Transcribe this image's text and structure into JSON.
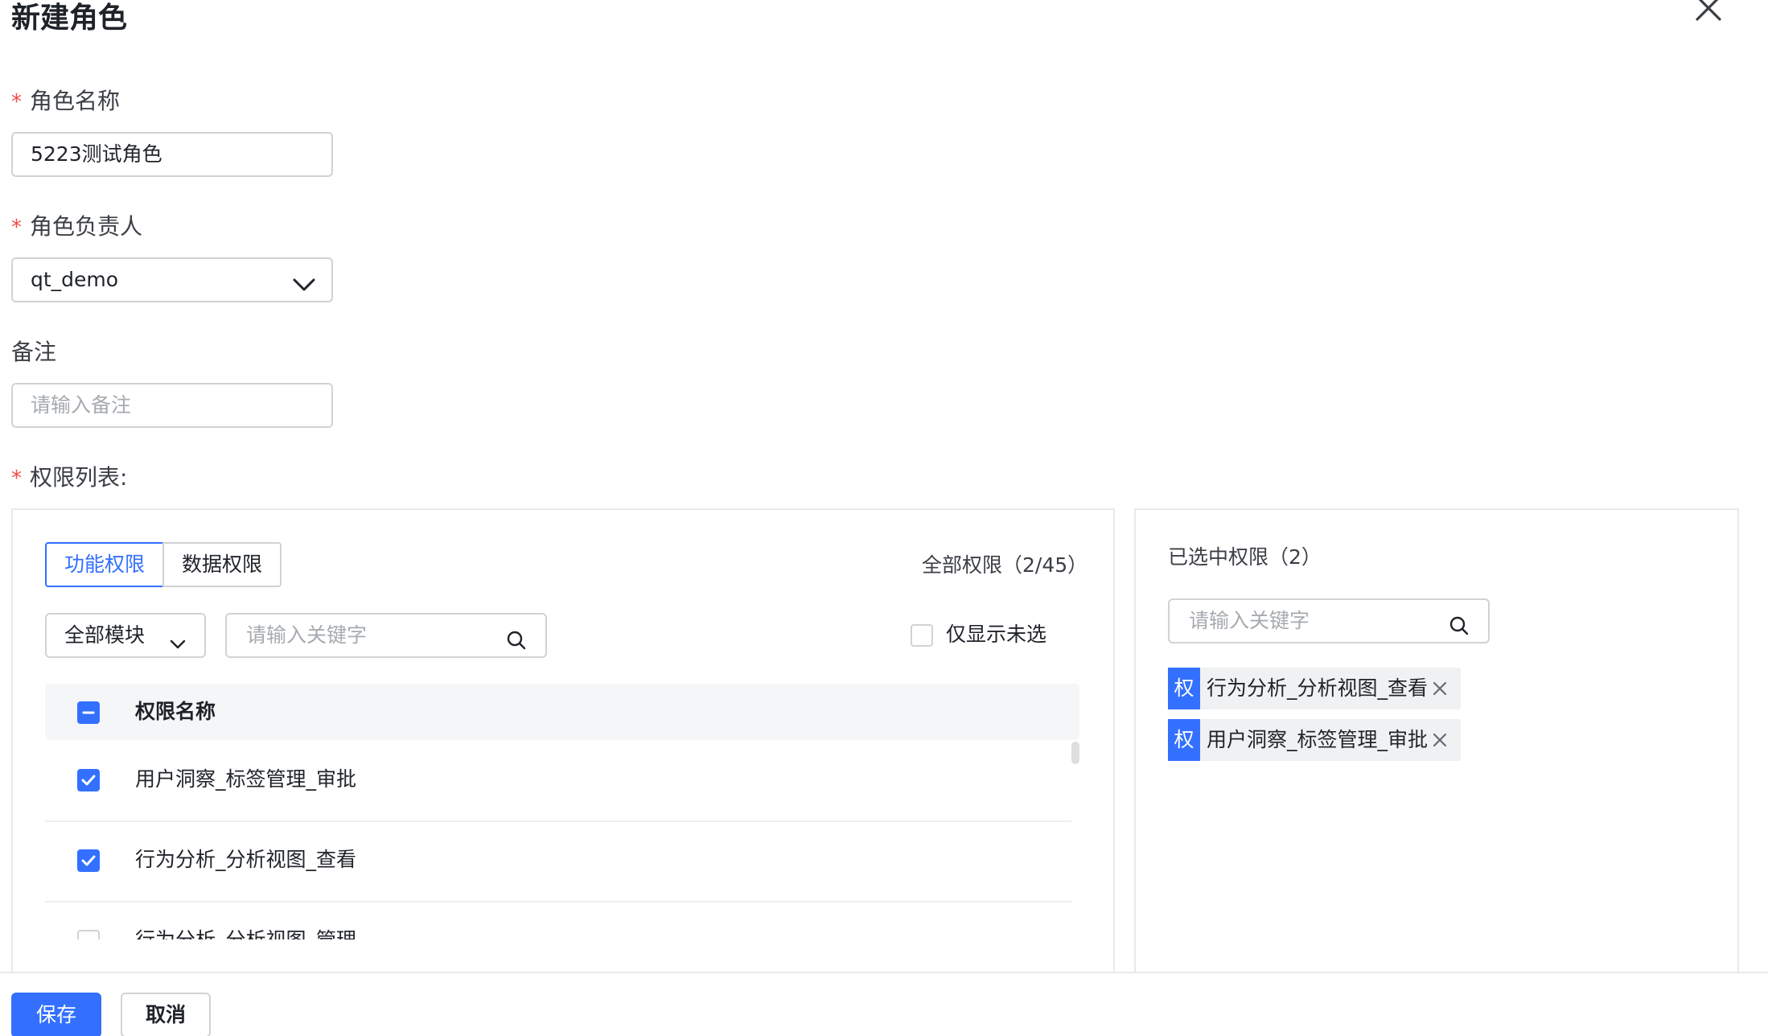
{
  "dialog": {
    "title": "新建角色"
  },
  "form": {
    "role_name": {
      "label": "角色名称",
      "value": "5223测试角色"
    },
    "role_owner": {
      "label": "角色负责人",
      "value": "qt_demo"
    },
    "remark": {
      "label": "备注",
      "placeholder": "请输入备注"
    },
    "permission_list": {
      "label": "权限列表:"
    },
    "required_mark": "*"
  },
  "left_panel": {
    "tabs": [
      {
        "label": "功能权限",
        "active": true
      },
      {
        "label": "数据权限",
        "active": false
      }
    ],
    "total_label": "全部权限（2/45）",
    "module_select": "全部模块",
    "search_placeholder": "请输入关键字",
    "only_unselected": "仅显示未选",
    "table_header": "权限名称",
    "rows": [
      {
        "label": "用户洞察_标签管理_审批",
        "checked": true
      },
      {
        "label": "行为分析_分析视图_查看",
        "checked": true
      },
      {
        "label": "行为分析_分析视图_管理",
        "checked": false
      }
    ]
  },
  "right_panel": {
    "title": "已选中权限（2）",
    "search_placeholder": "请输入关键字",
    "badge": "权",
    "selected": [
      {
        "label": "行为分析_分析视图_查看"
      },
      {
        "label": "用户洞察_标签管理_审批"
      }
    ]
  },
  "footer": {
    "save": "保存",
    "cancel": "取消"
  },
  "colors": {
    "primary": "#3370ff",
    "required": "#f54a45",
    "border": "#d0d3d6"
  }
}
